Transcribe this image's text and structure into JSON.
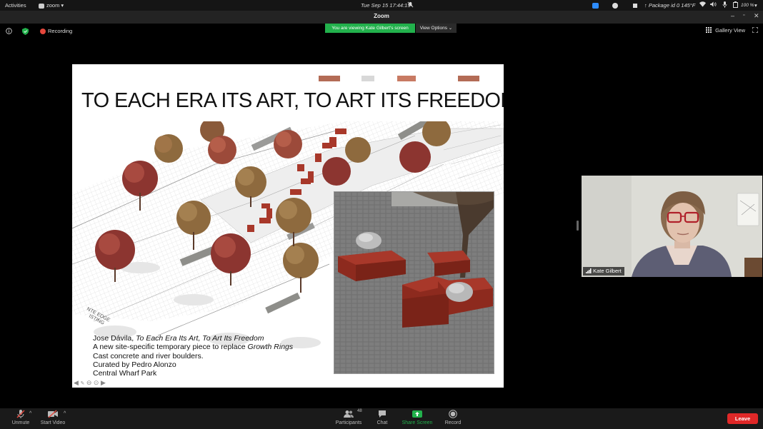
{
  "topbar": {
    "activities": "Activities",
    "app_menu": "zoom",
    "datetime": "Tue Sep 15  17:44:15",
    "weather": "↑ Package id 0 145°F",
    "battery": "100 %"
  },
  "window": {
    "title": "Zoom"
  },
  "meeting": {
    "recording_label": "Recording",
    "viewing_banner": "You are viewing Kate Gilbert's screen",
    "view_options": "View Options",
    "gallery_view": "Gallery View"
  },
  "slide": {
    "title": "TO EACH ERA ITS ART, TO ART ITS FREEDOM",
    "caption": {
      "line1_prefix": "Jose Dávila, ",
      "line1_italic": "To Each Era Its Art, To Art Its Freedom",
      "line2_prefix": "A new site-specific temporary piece to replace ",
      "line2_italic": "Growth Rings",
      "line3": "Cast concrete and river boulders.",
      "line4": "Curated by Pedro Alonzo",
      "line5": "Central Wharf Park"
    },
    "plan_labels": [
      "NTE EDGE",
      "ISTING"
    ]
  },
  "participant": {
    "name": "Kate Gilbert"
  },
  "toolbar": {
    "unmute": "Unmute",
    "start_video": "Start Video",
    "participants": "Participants",
    "participants_count": "48",
    "chat": "Chat",
    "share_screen": "Share Screen",
    "record": "Record",
    "leave": "Leave"
  },
  "colors": {
    "share_green": "#22b14c",
    "leave_red": "#e02828",
    "brick": "#a8382a"
  },
  "icons": [
    "zoom-app-icon",
    "bell-muted-icon",
    "wifi-icon",
    "volume-icon",
    "mic-icon",
    "battery-icon",
    "info-icon",
    "shield-icon",
    "record-dot-icon",
    "grid-icon",
    "fullscreen-icon",
    "mic-muted-icon",
    "video-muted-icon",
    "participants-icon",
    "chat-icon",
    "share-screen-icon",
    "record-icon"
  ]
}
